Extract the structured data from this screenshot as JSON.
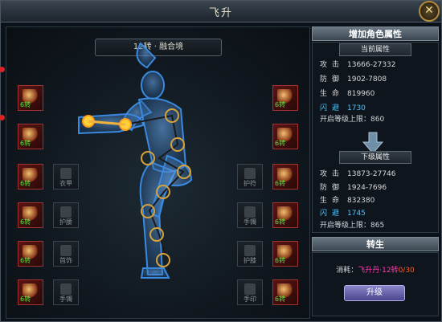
{
  "window": {
    "title": "飞升",
    "close_symbol": "✕"
  },
  "realm_banner": "12转 · 融合境",
  "left_slots": [
    {
      "level": "6转",
      "icon": "red-spear-icon"
    },
    {
      "level": "6转",
      "icon": "red-helmet-icon"
    },
    {
      "level": "6转",
      "icon": "red-weapon-icon"
    },
    {
      "level": "6转",
      "icon": "red-armor-icon"
    },
    {
      "level": "6转",
      "icon": "red-ring-icon"
    },
    {
      "level": "6转",
      "icon": "red-necklace-icon"
    }
  ],
  "right_slots": [
    {
      "level": "6转",
      "icon": "green-helmet-icon"
    },
    {
      "level": "6转",
      "icon": "green-mask-icon"
    },
    {
      "level": "6转",
      "icon": "silver-armor-icon"
    },
    {
      "level": "6转",
      "icon": "gold-helmet-icon"
    },
    {
      "level": "6转",
      "icon": "red-boots-icon"
    },
    {
      "level": "6转",
      "icon": "green-belt-icon"
    }
  ],
  "left_empty_slots": [
    {
      "label": "衣甲"
    },
    {
      "label": "护腰"
    },
    {
      "label": "首饰"
    },
    {
      "label": "手镯"
    }
  ],
  "right_empty_slots": [
    {
      "label": "护符"
    },
    {
      "label": "手镯"
    },
    {
      "label": "护膝"
    },
    {
      "label": "手印"
    }
  ],
  "attributes_panel": {
    "header": "增加角色属性",
    "current_label": "当前属性",
    "next_label": "下级属性",
    "current": [
      {
        "name": "攻击",
        "value": "13666-27332",
        "style": "white"
      },
      {
        "name": "防御",
        "value": "1902-7808",
        "style": "white"
      },
      {
        "name": "生命",
        "value": "819960",
        "style": "white"
      },
      {
        "name": "闪避",
        "value": "1730",
        "style": "cyan"
      }
    ],
    "current_unlock": "开启等级上限：860",
    "next": [
      {
        "name": "攻击",
        "value": "13873-27746",
        "style": "white"
      },
      {
        "name": "防御",
        "value": "1924-7696",
        "style": "white"
      },
      {
        "name": "生命",
        "value": "832380",
        "style": "white"
      },
      {
        "name": "闪避",
        "value": "1745",
        "style": "cyan"
      }
    ],
    "next_unlock": "开启等级上限：865"
  },
  "rebirth": {
    "header": "转生",
    "cost_label": "消耗：",
    "cost_item": "飞升丹·12转",
    "cost_count": "0/30",
    "button": "升级"
  },
  "colors": {
    "gold_meridian": "#f2b33a",
    "body_blue": "#3f7fbf",
    "cost_item": "#ff3cb4",
    "cost_count": "#ff5a2a"
  }
}
